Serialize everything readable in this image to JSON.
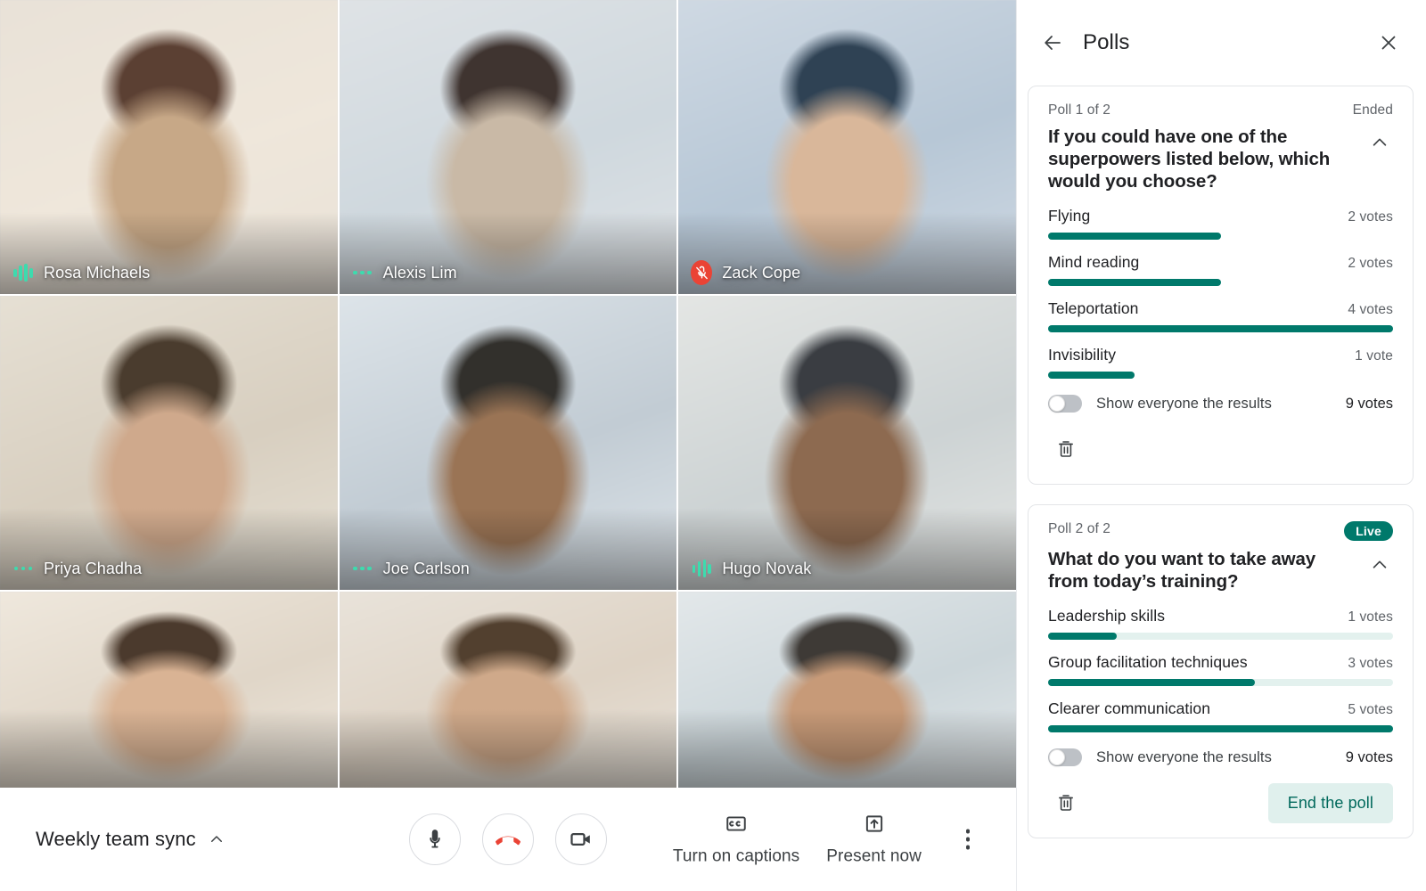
{
  "meeting": {
    "name": "Weekly team sync",
    "expand_icon": "chevron-up-icon",
    "controls": {
      "mic_label": "microphone",
      "hangup_label": "leave call",
      "camera_label": "camera",
      "captions_label": "Turn on captions",
      "present_label": "Present now",
      "more_label": "More options"
    }
  },
  "participants": [
    {
      "name": "Rosa Michaels",
      "indicator": "speaking-wave-icon",
      "muted": false,
      "tone": "#7a5c4e"
    },
    {
      "name": "Alexis Lim",
      "indicator": "audio-dots-icon",
      "muted": false,
      "tone": "#6f6258"
    },
    {
      "name": "Zack Cope",
      "indicator": "mic-off-icon",
      "muted": true,
      "tone": "#8d7b6b"
    },
    {
      "name": "Priya Chadha",
      "indicator": "audio-dots-icon",
      "muted": false,
      "tone": "#9d8874"
    },
    {
      "name": "Joe Carlson",
      "indicator": "audio-dots-icon",
      "muted": false,
      "tone": "#7e6e5f"
    },
    {
      "name": "Hugo Novak",
      "indicator": "speaking-wave-icon",
      "muted": false,
      "tone": "#877a6d"
    },
    {
      "name": "",
      "indicator": "",
      "muted": false,
      "tone": "#b3a190"
    },
    {
      "name": "",
      "indicator": "",
      "muted": false,
      "tone": "#a08d7c"
    },
    {
      "name": "",
      "indicator": "",
      "muted": false,
      "tone": "#9c8f84"
    }
  ],
  "panel": {
    "title": "Polls",
    "back_icon": "back-arrow-icon",
    "close_icon": "close-icon",
    "polls": [
      {
        "index_label": "Poll 1 of 2",
        "status": "Ended",
        "status_kind": "text",
        "question": "If you could have one of the superpowers listed below, which would you choose?",
        "options": [
          {
            "label": "Flying",
            "votes_label": "2 votes",
            "votes": 2
          },
          {
            "label": "Mind reading",
            "votes_label": "2 votes",
            "votes": 2
          },
          {
            "label": "Teleportation",
            "votes_label": "4 votes",
            "votes": 4
          },
          {
            "label": "Invisibility",
            "votes_label": "1 vote",
            "votes": 1
          }
        ],
        "max_votes": 4,
        "show_track_on_all": false,
        "toggle_label": "Show everyone the results",
        "toggle_on": false,
        "total_votes_label": "9  votes",
        "delete_icon": "trash-icon",
        "action_label": null
      },
      {
        "index_label": "Poll 2 of 2",
        "status": "Live",
        "status_kind": "badge",
        "question": "What do you want to take away from today’s training?",
        "options": [
          {
            "label": "Leadership skills",
            "votes_label": "1 votes",
            "votes": 1
          },
          {
            "label": "Group facilitation techniques",
            "votes_label": "3 votes",
            "votes": 3
          },
          {
            "label": "Clearer communication",
            "votes_label": "5 votes",
            "votes": 5
          }
        ],
        "max_votes": 5,
        "show_track_on_all": true,
        "toggle_label": "Show everyone the results",
        "toggle_on": false,
        "total_votes_label": "9  votes",
        "delete_icon": "trash-icon",
        "action_label": "End the poll"
      }
    ]
  },
  "colors": {
    "poll_fill": "#00796b",
    "poll_track": "#e3f1ee",
    "live_badge": "#00796b",
    "end_poll_bg": "#e0f0ed",
    "end_poll_text": "#00695c",
    "mute_red": "#ea4335",
    "indicator_green": "#3ddbae"
  },
  "chart_data": [
    {
      "type": "bar",
      "title": "If you could have one of the superpowers listed below, which would you choose?",
      "categories": [
        "Flying",
        "Mind reading",
        "Teleportation",
        "Invisibility"
      ],
      "values": [
        2,
        2,
        4,
        1
      ],
      "xlabel": "",
      "ylabel": "votes",
      "ylim": [
        0,
        4
      ],
      "total": 9,
      "status": "Ended",
      "orientation": "horizontal",
      "grid": false,
      "legend": "none"
    },
    {
      "type": "bar",
      "title": "What do you want to take away from today’s training?",
      "categories": [
        "Leadership skills",
        "Group facilitation techniques",
        "Clearer communication"
      ],
      "values": [
        1,
        3,
        5
      ],
      "xlabel": "",
      "ylabel": "votes",
      "ylim": [
        0,
        5
      ],
      "total": 9,
      "status": "Live",
      "orientation": "horizontal",
      "grid": false,
      "legend": "none"
    }
  ]
}
